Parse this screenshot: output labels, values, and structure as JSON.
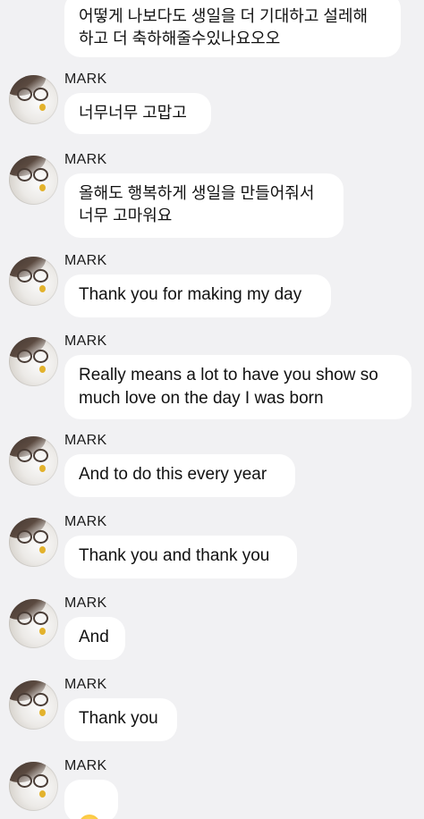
{
  "chat": {
    "messages": [
      {
        "sender": "",
        "text": "어떻게 나보다도 생일을 더 기대하고 설레해\n하고 더 축하해줄수있나요오오",
        "lang": "ko"
      },
      {
        "sender": "MARK",
        "text": "너무너무 고맙고",
        "lang": "ko"
      },
      {
        "sender": "MARK",
        "text": "올해도 행복하게 생일을 만들어줘서\n너무 고마워요",
        "lang": "ko"
      },
      {
        "sender": "MARK",
        "text": "Thank you for making my day",
        "lang": "en"
      },
      {
        "sender": "MARK",
        "text": "Really means a lot to have you show so\nmuch love on the day I was born",
        "lang": "en"
      },
      {
        "sender": "MARK",
        "text": "And to do this every year",
        "lang": "en"
      },
      {
        "sender": "MARK",
        "text": "Thank you and thank you",
        "lang": "en"
      },
      {
        "sender": "MARK",
        "text": "And",
        "lang": "en"
      },
      {
        "sender": "MARK",
        "text": "Thank you",
        "lang": "en"
      },
      {
        "sender": "MARK",
        "text": "",
        "emoji": "heart-eyes-emoji",
        "lang": "emoji"
      }
    ]
  },
  "colors": {
    "background": "#f1f1f3",
    "bubble": "#ffffff",
    "text": "#111111",
    "heart": "#e6203a"
  }
}
